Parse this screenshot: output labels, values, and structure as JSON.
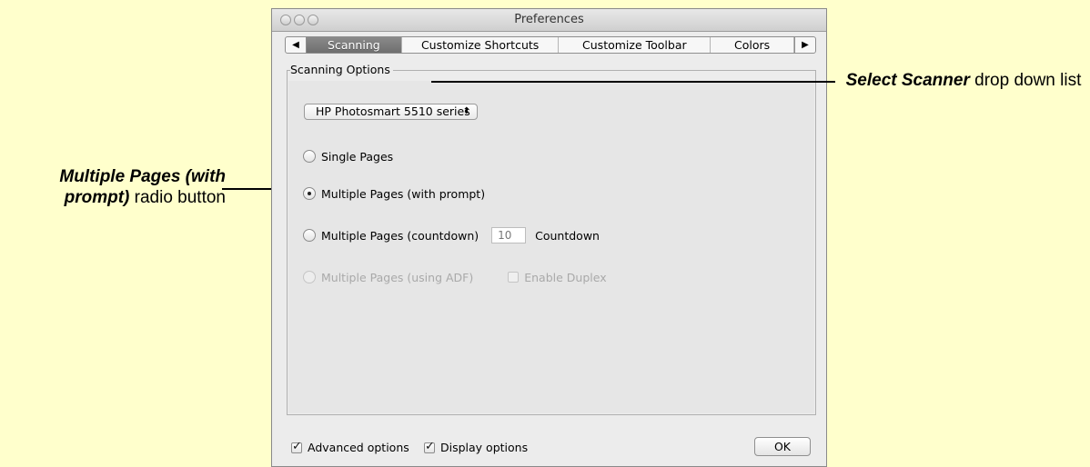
{
  "window": {
    "title": "Preferences"
  },
  "tabs": {
    "items": [
      {
        "label": "Scanning",
        "selected": true
      },
      {
        "label": "Customize Shortcuts",
        "selected": false
      },
      {
        "label": "Customize Toolbar",
        "selected": false
      },
      {
        "label": "Colors",
        "selected": false
      }
    ],
    "prev_icon": "triangle-left-icon",
    "next_icon": "triangle-right-icon"
  },
  "scanning": {
    "group_label": "Scanning Options",
    "scanner_select": {
      "value": "HP Photosmart 5510 series"
    },
    "options": {
      "single": {
        "label": "Single Pages",
        "checked": false,
        "enabled": true
      },
      "multi_prompt": {
        "label": "Multiple Pages (with prompt)",
        "checked": true,
        "enabled": true
      },
      "multi_countdown": {
        "label": "Multiple Pages (countdown)",
        "checked": false,
        "enabled": true
      },
      "multi_adf": {
        "label": "Multiple Pages (using ADF)",
        "checked": false,
        "enabled": false
      }
    },
    "countdown": {
      "value": "10",
      "label": "Countdown"
    },
    "duplex": {
      "label": "Enable Duplex",
      "checked": false,
      "enabled": false
    }
  },
  "footer": {
    "advanced": {
      "label": "Advanced options",
      "checked": true
    },
    "display": {
      "label": "Display options",
      "checked": true
    },
    "ok_label": "OK"
  },
  "callouts": {
    "left": {
      "bold": "Multiple Pages (with prompt)",
      "rest": " radio button"
    },
    "right": {
      "bold": "Select Scanner",
      "rest": " drop down list"
    }
  },
  "colors": {
    "background": "#ffffcc",
    "window": "#ececec",
    "selected_tab": "#7a7a7a"
  }
}
